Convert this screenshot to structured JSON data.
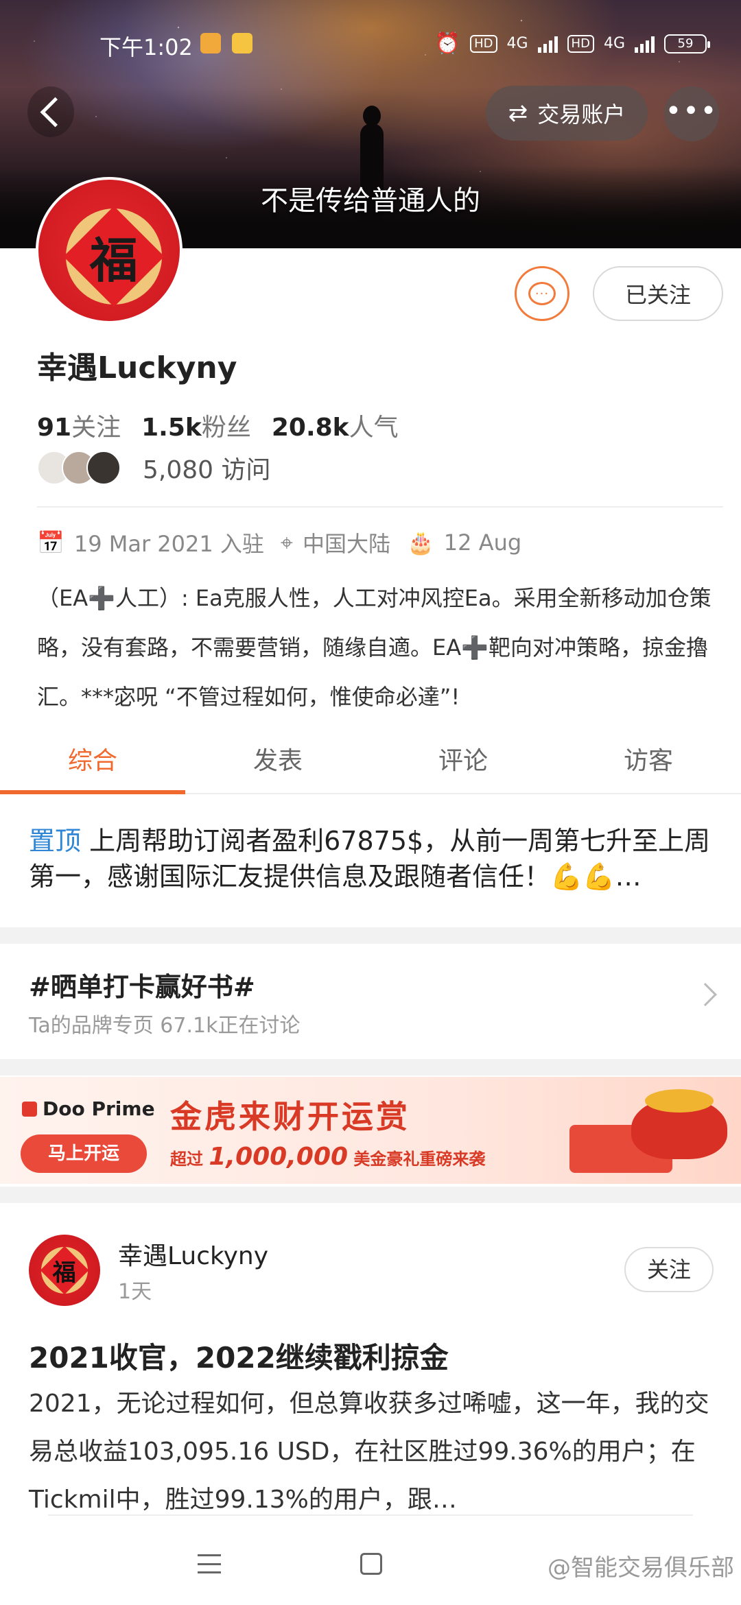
{
  "status_bar": {
    "time": "下午1:02",
    "network1": "4G",
    "network2": "4G",
    "hd1": "HD",
    "hd2": "HD",
    "battery": "59"
  },
  "header": {
    "caption": "不是传给普通人的",
    "trade_account_label": "交易账户",
    "more_label": "•••"
  },
  "profile": {
    "username": "幸遇Luckyny",
    "avatar_char": "福",
    "follow_state": "已关注",
    "message_icon": "···",
    "stats": [
      {
        "value": "91",
        "label": "关注"
      },
      {
        "value": "1.5k",
        "label": "粉丝"
      },
      {
        "value": "20.8k",
        "label": "人气"
      }
    ],
    "visits": "5,080 访问",
    "joined": "19 Mar 2021 入驻",
    "location": "中国大陆",
    "birthday": "12 Aug",
    "bio": "（EA➕人工）: Ea克服人性，人工对冲风控Ea。采用全新移动加仓策略，没有套路，不需要营销，随缘自適。EA➕靶向对冲策略，掠金擼汇。***宓呪 “不管过程如何，惟使命必達”!"
  },
  "tabs": [
    {
      "label": "综合",
      "active": true
    },
    {
      "label": "发表",
      "active": false
    },
    {
      "label": "评论",
      "active": false
    },
    {
      "label": "访客",
      "active": false
    }
  ],
  "pinned": {
    "tag": "置顶",
    "text": "上周帮助订阅者盈利67875$，从前一周第七升至上周第一，感谢国际汇友提供信息及跟随者信任！💪💪…"
  },
  "topic": {
    "title": "#晒单打卡赢好书#",
    "subtitle": "Ta的品牌专页  67.1k正在讨论"
  },
  "ad": {
    "brand": "Doo Prime",
    "cta": "马上开运",
    "headline": "金虎来财开运赏",
    "sub_prefix": "超过",
    "sub_amount": "1,000,000",
    "sub_suffix": "美金豪礼重磅来袭"
  },
  "post": {
    "author": "幸遇Luckyny",
    "time": "1天",
    "follow_label": "关注",
    "avatar_char": "福",
    "title": "2021收官，2022继续戳利掠金",
    "body": "2021，无论过程如何，但总算收获多过唏嘘，这一年，我的交易总收益103,095.16 USD，在社区胜过99.36%的用户；在Tickmil中，胜过99.13%的用户，跟…"
  },
  "watermark": "@智能交易俱乐部"
}
